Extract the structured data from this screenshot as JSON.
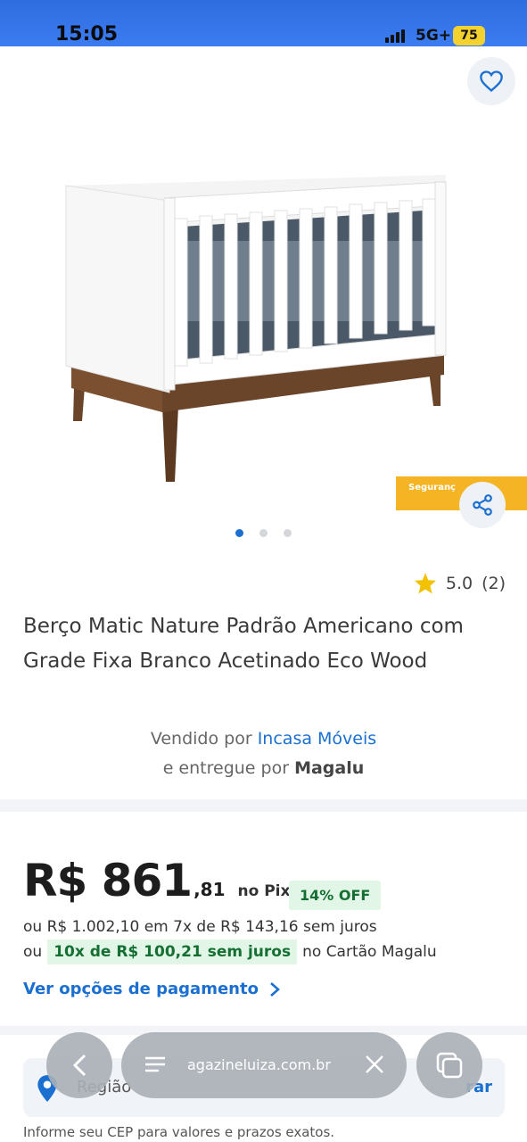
{
  "status_bar": {
    "time": "15:05",
    "network": "5G+",
    "battery": "75"
  },
  "icons": {
    "favorite": "heart-outline-icon",
    "share": "share-icon",
    "rating_star": "star-icon",
    "location": "location-pin-icon",
    "back": "chevron-left-icon",
    "menu": "menu-icon",
    "close": "close-icon",
    "tabs": "tabs-icon",
    "payment_arrow": "chevron-right-icon"
  },
  "gallery": {
    "promo_text": "Seguranç",
    "dots_total": 3,
    "active_index": 0
  },
  "rating": {
    "value": "5.0",
    "count": "(2)"
  },
  "product": {
    "title": "Berço Matic Nature Padrão Americano com Grade Fixa Branco Acetinado Eco Wood"
  },
  "seller": {
    "sold_by_prefix": "Vendido por",
    "sold_by_name": "Incasa Móveis",
    "delivered_prefix": "e entregue por",
    "delivered_name": "Magalu"
  },
  "price": {
    "main": "R$ 861",
    "cents": ",81",
    "method": "no Pix",
    "discount": "14% OFF",
    "installment_1": "ou R$ 1.002,10 em 7x de R$ 143,16 sem juros",
    "installment_2_prefix": "ou",
    "installment_2_highlight": "10x de R$ 100,21 sem juros",
    "installment_2_suffix": "no Cartão Magalu",
    "payment_options_link": "Ver opções de pagamento"
  },
  "cep": {
    "label": "Região",
    "action": "rar",
    "hint": "Informe seu CEP para valores e prazos exatos."
  },
  "browser": {
    "url": "agazineluiza.com.br"
  },
  "colors": {
    "status_bar": "#3b7cf0",
    "link_blue": "#1a6fd1",
    "discount_green": "#156f32",
    "discount_bg": "#e2f6e8",
    "star_yellow": "#f2c200",
    "promo_yellow": "#f5b423"
  }
}
